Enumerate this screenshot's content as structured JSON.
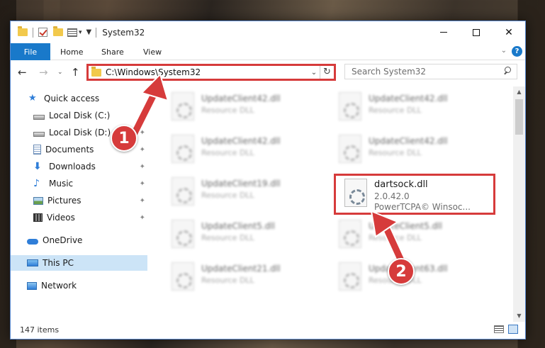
{
  "window": {
    "title": "System32",
    "controls": {
      "minimize": "",
      "maximize": "",
      "close": "✕"
    }
  },
  "ribbon": {
    "tabs": [
      {
        "label": "File",
        "active": true
      },
      {
        "label": "Home"
      },
      {
        "label": "Share"
      },
      {
        "label": "View"
      }
    ],
    "expand_icon": "⌄",
    "help_icon": "?"
  },
  "nav": {
    "back_icon": "←",
    "forward_icon": "→",
    "recent_icon": "⌄",
    "up_icon": "↑",
    "address": "C:\\Windows\\System32",
    "address_dropdown": "⌄",
    "refresh_icon": "↻",
    "search_placeholder": "Search System32"
  },
  "sidebar": {
    "items": [
      {
        "label": "Quick access",
        "icon": "star-icon",
        "glyph": "★",
        "pinned": false
      },
      {
        "label": "Local Disk (C:)",
        "icon": "drive-icon",
        "pinned": true
      },
      {
        "label": "Local Disk (D:)",
        "icon": "drive-icon",
        "pinned": true
      },
      {
        "label": "Documents",
        "icon": "documents-icon",
        "pinned": true
      },
      {
        "label": "Downloads",
        "icon": "downloads-icon",
        "glyph": "⬇",
        "pinned": true
      },
      {
        "label": "Music",
        "icon": "music-icon",
        "glyph": "♪",
        "pinned": true
      },
      {
        "label": "Pictures",
        "icon": "pictures-icon",
        "pinned": true
      },
      {
        "label": "Videos",
        "icon": "videos-icon",
        "pinned": true
      },
      {
        "label": "OneDrive",
        "icon": "onedrive-icon"
      },
      {
        "label": "This PC",
        "icon": "this-pc-icon",
        "selected": true
      },
      {
        "label": "Network",
        "icon": "network-icon"
      }
    ],
    "pin_glyph": "📌"
  },
  "files": {
    "left": [
      {
        "name": "UpdateClient42.dll",
        "type": "Resource DLL"
      },
      {
        "name": "UpdateClient42.dll",
        "type": "Resource DLL"
      },
      {
        "name": "UpdateClient19.dll",
        "type": "Resource DLL"
      },
      {
        "name": "UpdateClient5.dll",
        "type": "Resource DLL"
      },
      {
        "name": "UpdateClient21.dll",
        "type": "Resource DLL"
      }
    ],
    "right": [
      {
        "name": "UpdateClient42.dll",
        "type": "Resource DLL"
      },
      {
        "name": "UpdateClient42.dll",
        "type": "Resource DLL"
      },
      {
        "name": "UpdateClient5.dll",
        "type": "Resource DLL"
      },
      {
        "name": "UpdateClient63.dll",
        "type": "Resource DLL"
      }
    ],
    "highlighted": {
      "name": "dartsock.dll",
      "version": "2.0.42.0",
      "description": "PowerTCPA© Winsoc..."
    }
  },
  "status": {
    "item_count": "147 items"
  },
  "annotations": {
    "step1": "1",
    "step2": "2",
    "color": "#d63b3b"
  }
}
